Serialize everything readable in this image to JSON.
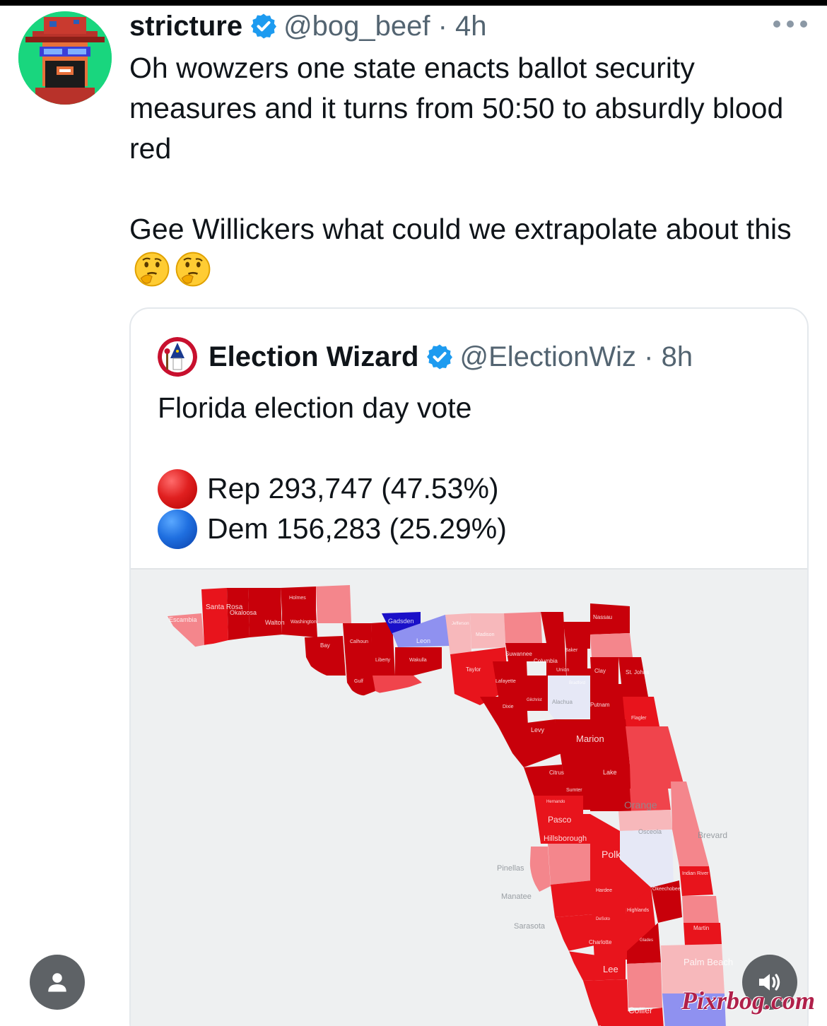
{
  "tweet": {
    "display_name": "stricture",
    "verified_icon": "verified-badge-icon",
    "meta": "@bog_beef · 4h",
    "paragraph_1": "Oh wowzers one state enacts ballot security measures and it turns from 50:50 to absurdly blood red",
    "paragraph_2": "Gee Willickers what could we extrapolate about this",
    "emoji": [
      "thinking-face",
      "thinking-face"
    ],
    "more_icon": "more-horizontal-icon"
  },
  "quote": {
    "display_name": "Election Wizard",
    "meta": "@ElectionWiz · 8h",
    "headline": "Florida election day vote",
    "results": [
      {
        "party": "Rep",
        "votes": "293,747",
        "pct": "(47.53%)",
        "text": "Rep 293,747 (47.53%)",
        "color": "#e02020"
      },
      {
        "party": "Dem",
        "votes": "156,283",
        "pct": "(25.29%)",
        "text": "Dem 156,283 (25.29%)",
        "color": "#1f6fe0"
      }
    ]
  },
  "map": {
    "colors": {
      "dark_red": "#c8000a",
      "red": "#e8141c",
      "mid_red": "#f0444c",
      "light_red": "#f4868c",
      "pale_red": "#f7b8bb",
      "lavender": "#e6e8f6",
      "light_blue": "#8f91f0",
      "dark_blue": "#1a10c8",
      "background": "#eef0f1"
    },
    "labels": {
      "escambia": "Escambia",
      "santa_rosa": "Santa Rosa",
      "okaloosa": "Okaloosa",
      "walton": "Walton",
      "holmes": "Holmes",
      "washington": "Washington",
      "bay": "Bay",
      "calhoun": "Calhoun",
      "gulf": "Gulf",
      "liberty": "Liberty",
      "gadsden": "Gadsden",
      "leon": "Leon",
      "wakulla": "Wakulla",
      "jefferson": "Jefferson",
      "madison": "Madison",
      "taylor": "Taylor",
      "suwannee": "Suwannee",
      "lafayette": "Lafayette",
      "columbia": "Columbia",
      "baker": "Baker",
      "union": "Union",
      "bradford": "Bradford",
      "nassau": "Nassau",
      "clay": "Clay",
      "st_johns": "St. Johns",
      "dixie": "Dixie",
      "gilchrist": "Gilchrist",
      "alachua": "Alachua",
      "putnam": "Putnam",
      "flagler": "Flagler",
      "levy": "Levy",
      "marion": "Marion",
      "citrus": "Citrus",
      "sumter": "Sumter",
      "lake": "Lake",
      "hernando": "Hernando",
      "orange": "Orange",
      "pasco": "Pasco",
      "hillsborough": "Hillsborough",
      "polk": "Polk",
      "osceola": "Osceola",
      "brevard": "Brevard",
      "pinellas": "Pinellas",
      "manatee": "Manatee",
      "hardee": "Hardee",
      "okeechobee": "Okeechobee",
      "indian_river": "Indian River",
      "highlands": "Highlands",
      "desoto": "DeSoto",
      "sarasota": "Sarasota",
      "martin": "Martin",
      "charlotte": "Charlotte",
      "glades": "Glades",
      "palm_beach": "Palm Beach",
      "lee": "Lee",
      "collier": "Collier"
    }
  },
  "overlay": {
    "profile_icon": "person-icon",
    "volume_icon": "volume-icon",
    "watermark": "Pixrbog.com"
  }
}
